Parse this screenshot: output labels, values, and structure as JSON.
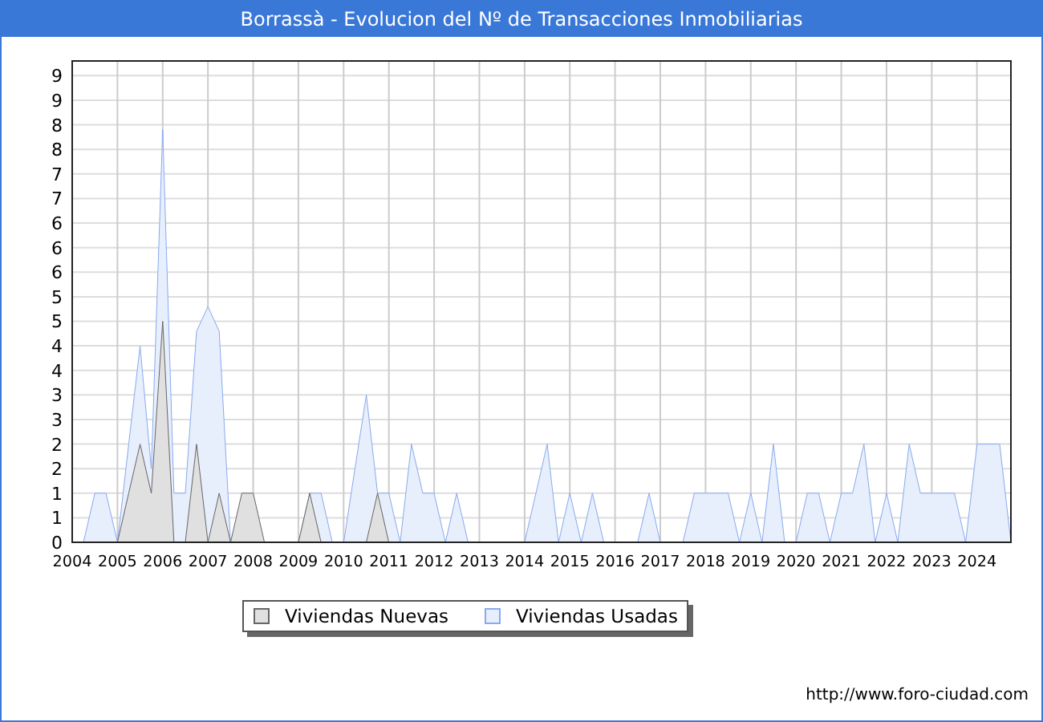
{
  "window": {
    "title": "Borrassà - Evolucion del Nº de Transacciones Inmobiliarias"
  },
  "chart_data": {
    "type": "area",
    "x": [
      2004,
      2004.25,
      2004.5,
      2004.75,
      2005,
      2005.25,
      2005.5,
      2005.75,
      2006,
      2006.25,
      2006.5,
      2006.75,
      2007,
      2007.25,
      2007.5,
      2007.75,
      2008,
      2008.25,
      2008.5,
      2008.75,
      2009,
      2009.25,
      2009.5,
      2009.75,
      2010,
      2010.25,
      2010.5,
      2010.75,
      2011,
      2011.25,
      2011.5,
      2011.75,
      2012,
      2012.25,
      2012.5,
      2012.75,
      2013,
      2013.25,
      2013.5,
      2013.75,
      2014,
      2014.25,
      2014.5,
      2014.75,
      2015,
      2015.25,
      2015.5,
      2015.75,
      2016,
      2016.25,
      2016.5,
      2016.75,
      2017,
      2017.25,
      2017.5,
      2017.75,
      2018,
      2018.25,
      2018.5,
      2018.75,
      2019,
      2019.25,
      2019.5,
      2019.75,
      2020,
      2020.25,
      2020.5,
      2020.75,
      2021,
      2021.25,
      2021.5,
      2021.75,
      2022,
      2022.25,
      2022.5,
      2022.75,
      2023,
      2023.25,
      2023.5,
      2023.75,
      2024,
      2024.25,
      2024.5,
      2024.75
    ],
    "series": [
      {
        "name": "Viviendas Nuevas",
        "color": "#666666",
        "values": [
          0,
          0,
          0,
          0,
          0,
          1,
          2,
          1,
          4.5,
          0,
          0,
          2,
          0,
          1,
          0,
          1,
          1,
          0,
          0,
          0,
          0,
          1,
          0,
          0,
          0,
          0,
          0,
          1,
          0,
          0,
          0,
          0,
          0,
          0,
          0,
          0,
          0,
          0,
          0,
          0,
          0,
          0,
          0,
          0,
          0,
          0,
          0,
          0,
          0,
          0,
          0,
          0,
          0,
          0,
          0,
          0,
          0,
          0,
          0,
          0,
          0,
          0,
          0,
          0,
          0,
          0,
          0,
          0,
          0,
          0,
          0,
          0,
          0,
          0,
          0,
          0,
          0,
          0,
          0,
          0,
          0,
          0,
          0,
          0
        ]
      },
      {
        "name": "Viviendas Usadas",
        "color": "#88aaee",
        "values": [
          0,
          0,
          1,
          1,
          0,
          2,
          4,
          1.5,
          8.4,
          1,
          1,
          4.3,
          4.8,
          4.3,
          0,
          0,
          0,
          0,
          0,
          0,
          0,
          1,
          1,
          0,
          0,
          1.5,
          3,
          1,
          1,
          0,
          2,
          1,
          1,
          0,
          1,
          0,
          0,
          0,
          0,
          0,
          0,
          1,
          2,
          0,
          1,
          0,
          1,
          0,
          0,
          0,
          0,
          1,
          0,
          0,
          0,
          1,
          1,
          1,
          1,
          0,
          1,
          0,
          2,
          0,
          0,
          1,
          1,
          0,
          1,
          1,
          2,
          0,
          1,
          0,
          2,
          1,
          1,
          1,
          1,
          0,
          2,
          2,
          2,
          0
        ]
      }
    ],
    "grid": true,
    "xlim": [
      2004,
      2024.75
    ],
    "ylim": [
      0,
      9.8
    ],
    "xticks": [
      2004,
      2005,
      2006,
      2007,
      2008,
      2009,
      2010,
      2011,
      2012,
      2013,
      2014,
      2015,
      2016,
      2017,
      2018,
      2019,
      2020,
      2021,
      2022,
      2023,
      2024
    ],
    "yticks": [
      {
        "value": 0,
        "label": "0"
      },
      {
        "value": 0.5,
        "label": "1"
      },
      {
        "value": 1,
        "label": "1"
      },
      {
        "value": 1.5,
        "label": "2"
      },
      {
        "value": 2,
        "label": "2"
      },
      {
        "value": 2.5,
        "label": "3"
      },
      {
        "value": 3,
        "label": "3"
      },
      {
        "value": 3.5,
        "label": "4"
      },
      {
        "value": 4,
        "label": "4"
      },
      {
        "value": 4.5,
        "label": "5"
      },
      {
        "value": 5,
        "label": "5"
      },
      {
        "value": 5.5,
        "label": "6"
      },
      {
        "value": 6,
        "label": "6"
      },
      {
        "value": 6.5,
        "label": "6"
      },
      {
        "value": 7,
        "label": "7"
      },
      {
        "value": 7.5,
        "label": "7"
      },
      {
        "value": 8,
        "label": "8"
      },
      {
        "value": 8.5,
        "label": "8"
      },
      {
        "value": 9,
        "label": "9"
      },
      {
        "value": 9.5,
        "label": "9"
      }
    ]
  },
  "footer": {
    "url": "http://www.foro-ciudad.com"
  }
}
